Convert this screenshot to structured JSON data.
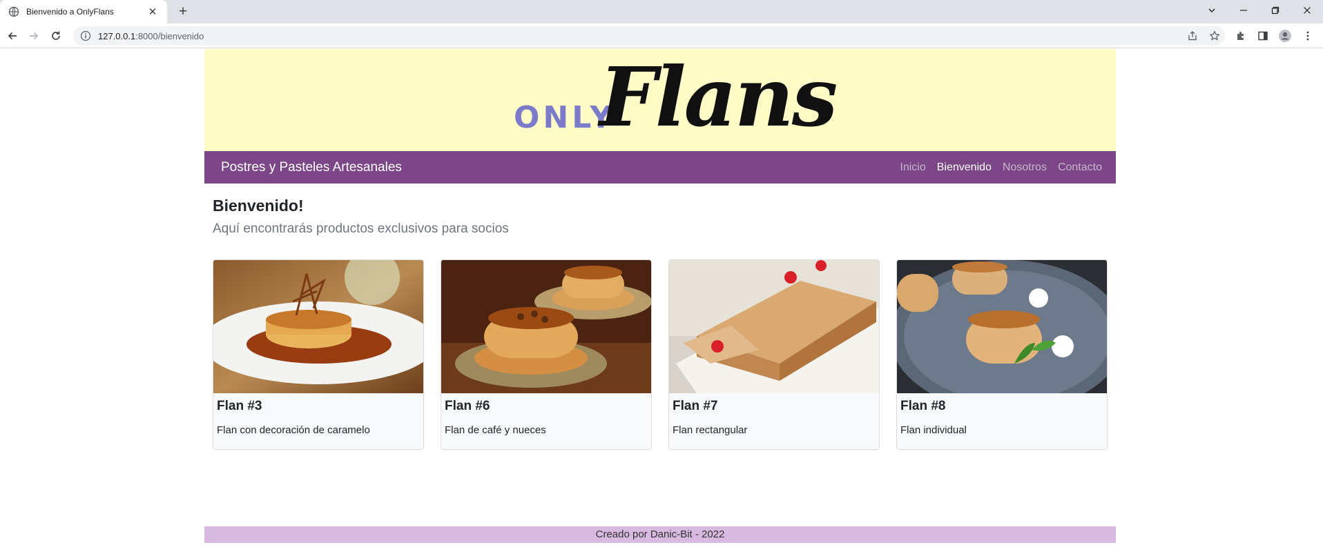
{
  "browser": {
    "tab_title": "Bienvenido a OnlyFlans",
    "url_host": "127.0.0.1",
    "url_rest": ":8000/bienvenido"
  },
  "site": {
    "logo_small": "ONLY",
    "logo_large": "Flans",
    "brand": "Postres y Pasteles Artesanales",
    "nav": [
      {
        "label": "Inicio"
      },
      {
        "label": "Bienvenido"
      },
      {
        "label": "Nosotros"
      },
      {
        "label": "Contacto"
      }
    ],
    "heading": "Bienvenido!",
    "subheading": "Aquí encontrarás productos exclusivos para socios",
    "cards": [
      {
        "title": "Flan #3",
        "desc": "Flan con decoración de caramelo"
      },
      {
        "title": "Flan #6",
        "desc": "Flan de café y nueces"
      },
      {
        "title": "Flan #7",
        "desc": "Flan rectangular"
      },
      {
        "title": "Flan #8",
        "desc": "Flan individual"
      }
    ],
    "footer": "Creado por Danic-Bit - 2022"
  },
  "colors": {
    "banner": "#fffcc8",
    "navbar": "#7b4787",
    "footer": "#d8b9df",
    "logo_only": "#7b7bc9"
  }
}
